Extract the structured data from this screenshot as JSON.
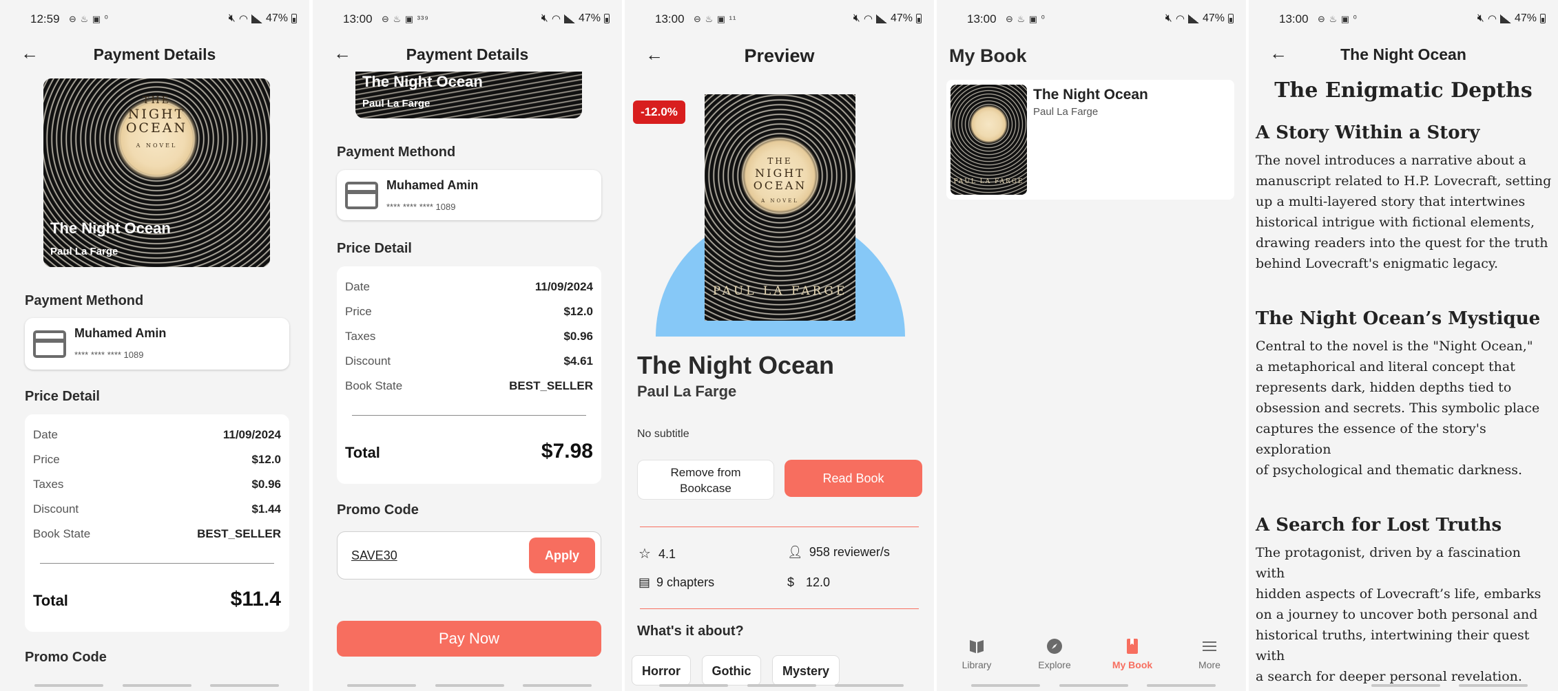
{
  "screens": [
    {
      "status": {
        "time": "12:59",
        "left_icons": "⊖ ♨ ▣ ⁰",
        "battery": "47%"
      },
      "header_title": "Payment Details",
      "book": {
        "title": "The Night Ocean",
        "author": "Paul La Farge",
        "cover_title_lines": [
          "THE",
          "NIGHT",
          "OCEAN"
        ],
        "cover_sub": "A NOVEL"
      },
      "payment_method_label": "Payment Methond",
      "card_holder": "Muhamed Amin",
      "card_number": "**** **** **** 1089",
      "price_detail_label": "Price Detail",
      "rows": [
        {
          "k": "Date",
          "v": "11/09/2024"
        },
        {
          "k": "Price",
          "v": "$12.0"
        },
        {
          "k": "Taxes",
          "v": "$0.96"
        },
        {
          "k": "Discount",
          "v": "$1.44"
        },
        {
          "k": "Book State",
          "v": "BEST_SELLER"
        }
      ],
      "total_label": "Total",
      "total_value": "$11.4",
      "promo_label": "Promo Code"
    },
    {
      "status": {
        "time": "13:00",
        "left_icons": "⊖ ♨ ▣ ³³⁹",
        "battery": "47%"
      },
      "header_title": "Payment Details",
      "book": {
        "title": "The Night Ocean",
        "author": "Paul La Farge"
      },
      "payment_method_label": "Payment Methond",
      "card_holder": "Muhamed Amin",
      "card_number": "**** **** **** 1089",
      "price_detail_label": "Price Detail",
      "rows": [
        {
          "k": "Date",
          "v": "11/09/2024"
        },
        {
          "k": "Price",
          "v": "$12.0"
        },
        {
          "k": "Taxes",
          "v": "$0.96"
        },
        {
          "k": "Discount",
          "v": "$4.61"
        },
        {
          "k": "Book State",
          "v": "BEST_SELLER"
        }
      ],
      "total_label": "Total",
      "total_value": "$7.98",
      "promo_label": "Promo Code",
      "promo_value": "SAVE30",
      "apply_label": "Apply",
      "pay_label": "Pay Now"
    },
    {
      "status": {
        "time": "13:00",
        "left_icons": "⊖ ♨ ▣ ¹¹",
        "battery": "47%"
      },
      "header_title": "Preview",
      "discount_badge": "-12.0%",
      "book": {
        "title": "The Night Ocean",
        "author": "Paul La Farge",
        "cover_title_lines": [
          "THE",
          "NIGHT",
          "OCEAN"
        ],
        "cover_sub": "A NOVEL",
        "cover_author_caps": "PAUL LA FARGE"
      },
      "subtitle": "No subtitle",
      "remove_label_line1": "Remove from",
      "remove_label_line2": "Bookcase",
      "read_label": "Read Book",
      "rating": "4.1",
      "reviewers": "958 reviewer/s",
      "chapters": "9 chapters",
      "price": "12.0",
      "about_label": "What's it about?",
      "genres": [
        "Horror",
        "Gothic",
        "Mystery"
      ]
    },
    {
      "status": {
        "time": "13:00",
        "left_icons": "⊖ ♨ ▣ ⁰",
        "battery": "47%"
      },
      "header_title": "My Book",
      "book": {
        "title": "The Night Ocean",
        "author": "Paul La Farge",
        "cover_author_caps": "PAUL LA FARGE"
      },
      "nav": [
        {
          "label": "Library",
          "icon": "library-icon"
        },
        {
          "label": "Explore",
          "icon": "compass-icon"
        },
        {
          "label": "My Book",
          "icon": "bookmark-book-icon"
        },
        {
          "label": "More",
          "icon": "menu-icon"
        }
      ],
      "active_color": "#f76e5f"
    },
    {
      "status": {
        "time": "13:00",
        "left_icons": "⊖ ♨ ▣ ⁰",
        "battery": "47%"
      },
      "header_title": "The Night Ocean",
      "main_heading": "The Enigmatic Depths",
      "sections": [
        {
          "heading": "A Story Within a Story",
          "lines": [
            "The novel introduces a narrative about a",
            "manuscript related to H.P. Lovecraft, setting",
            "up a multi-layered story that intertwines",
            "historical intrigue with fictional elements,",
            "drawing readers into the quest for the truth",
            "behind Lovecraft's enigmatic legacy."
          ]
        },
        {
          "heading": "The Night Ocean’s Mystique",
          "lines": [
            "Central to the novel is the \"Night Ocean,\"",
            "a metaphorical and literal concept that",
            "represents dark, hidden depths tied to",
            "obsession and secrets. This symbolic place",
            "captures the essence of the story's exploration",
            "of psychological and thematic darkness."
          ]
        },
        {
          "heading": "A Search for Lost Truths",
          "lines": [
            "The protagonist, driven by a fascination with",
            "hidden aspects of Lovecraft’s life, embarks",
            "on a journey to uncover both personal and",
            "historical truths, intertwining their quest with",
            "a search for deeper personal revelation."
          ]
        }
      ]
    }
  ],
  "colors": {
    "accent": "#f76e5f",
    "badge": "#d81e1e",
    "semicircle": "#86c8f7",
    "bg": "#f4f4f4"
  }
}
